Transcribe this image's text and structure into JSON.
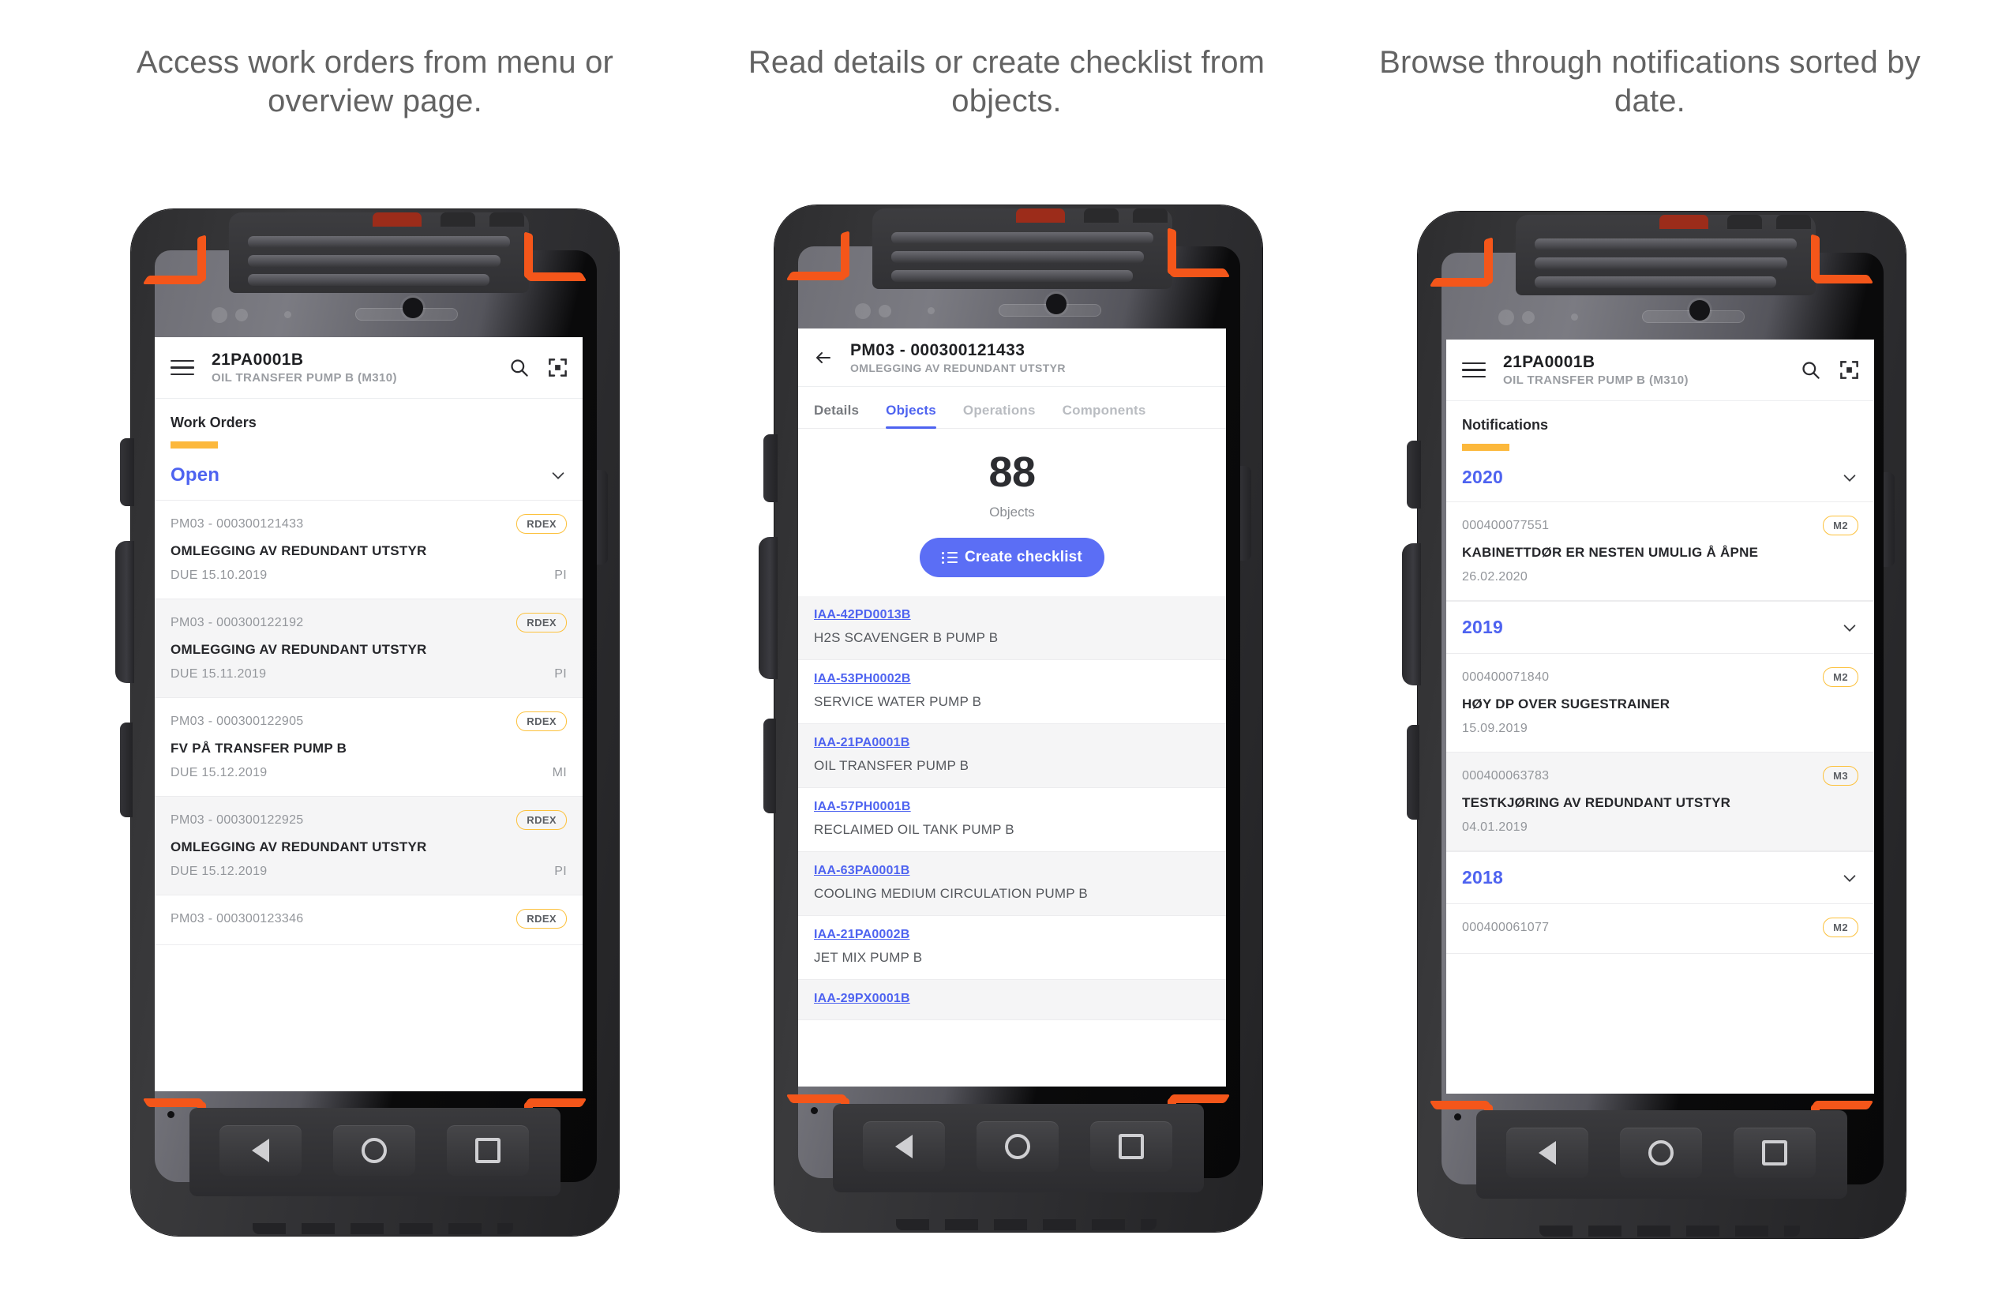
{
  "captions": {
    "first": "Access work orders from menu or overview page.",
    "second": "Read details or create checklist from objects.",
    "third": "Browse through notifications sorted by date."
  },
  "colors": {
    "accent_yellow": "#fcb83c",
    "link_blue": "#4e63f0",
    "button_blue": "#5b6ef5",
    "pill_border": "#fcc13c",
    "caption_grey": "#636363"
  },
  "phone1": {
    "appbar": {
      "menu_icon": "hamburger-icon",
      "title": "21PA0001B",
      "subtitle": "OIL TRANSFER PUMP B  (M310)",
      "search_icon": "search-icon",
      "scan_icon": "scan-icon"
    },
    "section": {
      "title": "Work Orders"
    },
    "group": {
      "label": "Open",
      "chevron_icon": "chevron-down-icon"
    },
    "items": [
      {
        "id": "PM03 - 000300121433",
        "tag": "RDEX",
        "title": "OMLEGGING AV REDUNDANT UTSTYR",
        "date": "DUE 15.10.2019",
        "code": "PI"
      },
      {
        "id": "PM03 - 000300122192",
        "tag": "RDEX",
        "title": "OMLEGGING AV REDUNDANT UTSTYR",
        "date": "DUE 15.11.2019",
        "code": "PI"
      },
      {
        "id": "PM03 - 000300122905",
        "tag": "RDEX",
        "title": "FV PÅ TRANSFER PUMP B",
        "date": "DUE 15.12.2019",
        "code": "MI"
      },
      {
        "id": "PM03 - 000300122925",
        "tag": "RDEX",
        "title": "OMLEGGING AV REDUNDANT UTSTYR",
        "date": "DUE 15.12.2019",
        "code": "PI"
      },
      {
        "id": "PM03 - 000300123346",
        "tag": "RDEX",
        "title": "",
        "date": "",
        "code": ""
      }
    ],
    "navkeys": {
      "back": "back-triangle-icon",
      "home": "home-circle-icon",
      "recent": "recent-square-icon"
    }
  },
  "phone2": {
    "appbar": {
      "back_icon": "back-arrow-icon",
      "title": "PM03 - 000300121433",
      "subtitle": "OMLEGGING AV REDUNDANT UTSTYR"
    },
    "tabs": [
      {
        "label": "Details",
        "active": false
      },
      {
        "label": "Objects",
        "active": true
      },
      {
        "label": "Operations",
        "active": false
      },
      {
        "label": "Components",
        "active": false
      }
    ],
    "count": {
      "value": "88",
      "label": "Objects"
    },
    "cta": {
      "label": "Create checklist",
      "icon": "list-icon"
    },
    "objects": [
      {
        "id": "IAA-42PD0013B",
        "name": "H2S SCAVENGER B PUMP B"
      },
      {
        "id": "IAA-53PH0002B",
        "name": "SERVICE WATER PUMP B"
      },
      {
        "id": "IAA-21PA0001B",
        "name": "OIL TRANSFER PUMP B"
      },
      {
        "id": "IAA-57PH0001B",
        "name": "RECLAIMED OIL TANK PUMP B"
      },
      {
        "id": "IAA-63PA0001B",
        "name": "COOLING MEDIUM CIRCULATION PUMP B"
      },
      {
        "id": "IAA-21PA0002B",
        "name": "JET MIX PUMP B"
      },
      {
        "id": "IAA-29PX0001B",
        "name": ""
      }
    ],
    "navkeys": {
      "back": "back-triangle-icon",
      "home": "home-circle-icon",
      "recent": "recent-square-icon"
    }
  },
  "phone3": {
    "appbar": {
      "menu_icon": "hamburger-icon",
      "title": "21PA0001B",
      "subtitle": "OIL TRANSFER PUMP B  (M310)",
      "search_icon": "search-icon",
      "scan_icon": "scan-icon"
    },
    "section": {
      "title": "Notifications"
    },
    "groups": [
      {
        "year": "2020",
        "chevron_icon": "chevron-down-icon",
        "items": [
          {
            "id": "000400077551",
            "tag": "M2",
            "title": "KABINETTDØR ER NESTEN UMULIG Å ÅPNE",
            "date": "26.02.2020"
          }
        ]
      },
      {
        "year": "2019",
        "chevron_icon": "chevron-down-icon",
        "items": [
          {
            "id": "000400071840",
            "tag": "M2",
            "title": "HØY DP OVER SUGESTRAINER",
            "date": "15.09.2019"
          },
          {
            "id": "000400063783",
            "tag": "M3",
            "title": "TESTKJØRING AV REDUNDANT UTSTYR",
            "date": "04.01.2019"
          }
        ]
      },
      {
        "year": "2018",
        "chevron_icon": "chevron-down-icon",
        "items": [
          {
            "id": "000400061077",
            "tag": "M2",
            "title": "",
            "date": ""
          }
        ]
      }
    ],
    "navkeys": {
      "back": "back-triangle-icon",
      "home": "home-circle-icon",
      "recent": "recent-square-icon"
    }
  }
}
